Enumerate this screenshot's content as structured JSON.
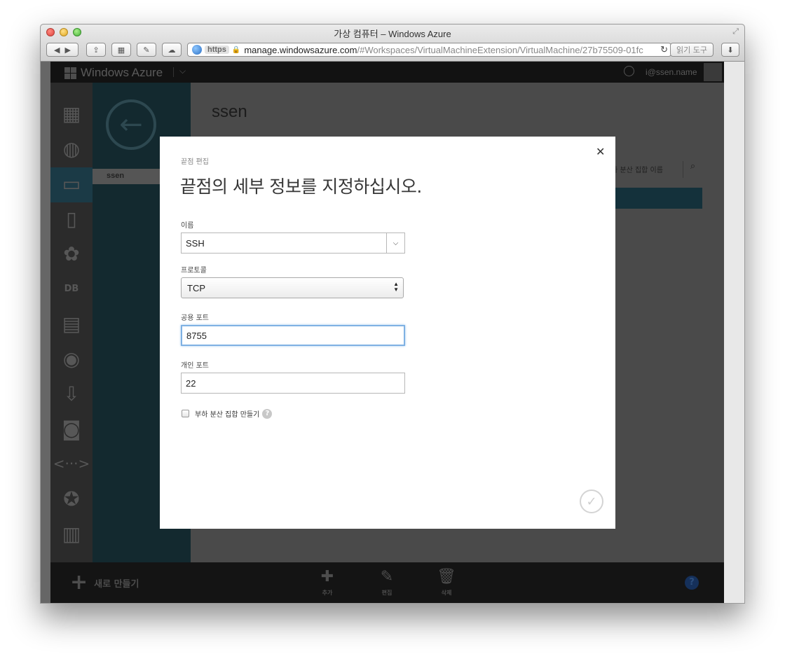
{
  "browser": {
    "title": "가상 컴퓨터 – Windows Azure",
    "url_scheme": "https",
    "url_host": "manage.windowsazure.com",
    "url_path": "/#Workspaces/VirtualMachineExtension/VirtualMachine/27b75509-01fc",
    "reader_label": "읽기 도구"
  },
  "topbar": {
    "brand": "Windows Azure",
    "user": "i@ssen.name"
  },
  "nav": {
    "items": [
      "all-items",
      "web-sites",
      "virtual-machines",
      "mobile-services",
      "cloud-services",
      "sql-databases",
      "storage",
      "media-services",
      "service-bus",
      "hdinsight",
      "networks",
      "traffic-manager",
      "management-services"
    ],
    "db_label": "DB"
  },
  "list": {
    "selected": "ssen"
  },
  "content": {
    "title": "ssen",
    "search_hint": "하 분산 집합 이름"
  },
  "bottombar": {
    "new_label": "새로 만들기",
    "commands": [
      {
        "label": "추가",
        "icon": "plus-icon"
      },
      {
        "label": "편집",
        "icon": "pencil-icon"
      },
      {
        "label": "삭제",
        "icon": "trash-icon"
      }
    ],
    "help": "?"
  },
  "dialog": {
    "subtitle": "끝점 편집",
    "title": "끝점의 세부 정보를 지정하십시오.",
    "name_label": "이름",
    "name_value": "SSH",
    "protocol_label": "프로토콜",
    "protocol_value": "TCP",
    "public_port_label": "공용 포트",
    "public_port_value": "8755",
    "private_port_label": "개인 포트",
    "private_port_value": "22",
    "lb_checkbox_label": "부하 분산 집합 만들기",
    "help": "?"
  }
}
